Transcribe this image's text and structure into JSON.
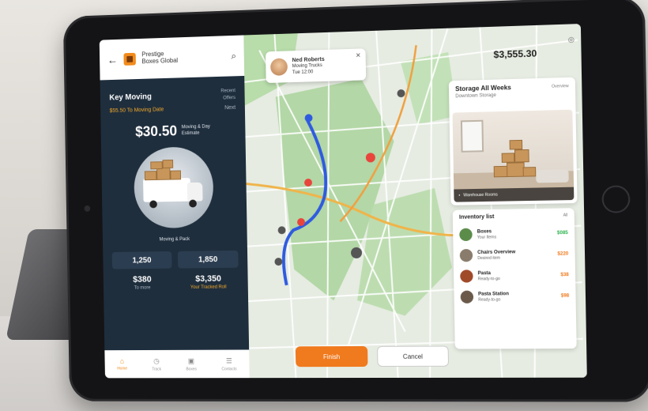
{
  "left_panel": {
    "brand_line1": "Prestige",
    "brand_line2": "Boxes Global",
    "key_title": "Key Moving",
    "key_side_1": "Recent",
    "key_side_2": "Offers",
    "orange_text": "$55.50 To Moving Date",
    "orange_side": "Next",
    "price": "$30.50",
    "price_note_1": "Moving & Day",
    "price_note_2": "Estimate",
    "truck_caption": "Moving & Pack",
    "stats": [
      {
        "value": "1,250",
        "boxed": true
      },
      {
        "value": "1,850",
        "boxed": true
      },
      {
        "value": "$380",
        "sub": "To more",
        "orange": false
      },
      {
        "value": "$3,350",
        "sub": "Your Tracked Roll",
        "orange": true
      }
    ],
    "nav": [
      {
        "label": "Home",
        "icon": "home-icon"
      },
      {
        "label": "Track",
        "icon": "clock-icon"
      },
      {
        "label": "Boxes",
        "icon": "box-icon"
      },
      {
        "label": "Contacts",
        "icon": "contacts-icon"
      }
    ]
  },
  "map": {
    "driver_name": "Ned Roberts",
    "driver_line1": "Moving Trucks",
    "driver_line2": "Tue 12:00",
    "primary_button": "Finish",
    "secondary_button": "Cancel"
  },
  "right_panel": {
    "top_price": "$3,555.30",
    "warehouse_title": "Storage All Weeks",
    "warehouse_title_side": "Overview",
    "warehouse_sub": "Downtown Storage",
    "warehouse_caption": "Warehouse Rooms",
    "list_title": "Inventory list",
    "list_title_side": "All",
    "items": [
      {
        "name": "Boxes",
        "desc": "Your Items",
        "value": "$085",
        "color": "#2bb24c",
        "avatar": "#5c8c4a"
      },
      {
        "name": "Chairs Overview",
        "desc": "Desired item",
        "value": "$220",
        "color": "#f07a1e",
        "avatar": "#8a7c6c"
      },
      {
        "name": "Pasta",
        "desc": "Ready-to-go",
        "value": "$38",
        "color": "#f07a1e",
        "avatar": "#a04a2a"
      },
      {
        "name": "Pasta Station",
        "desc": "Ready-to-go",
        "value": "$98",
        "color": "#f07a1e",
        "avatar": "#6b5a4a"
      }
    ]
  }
}
